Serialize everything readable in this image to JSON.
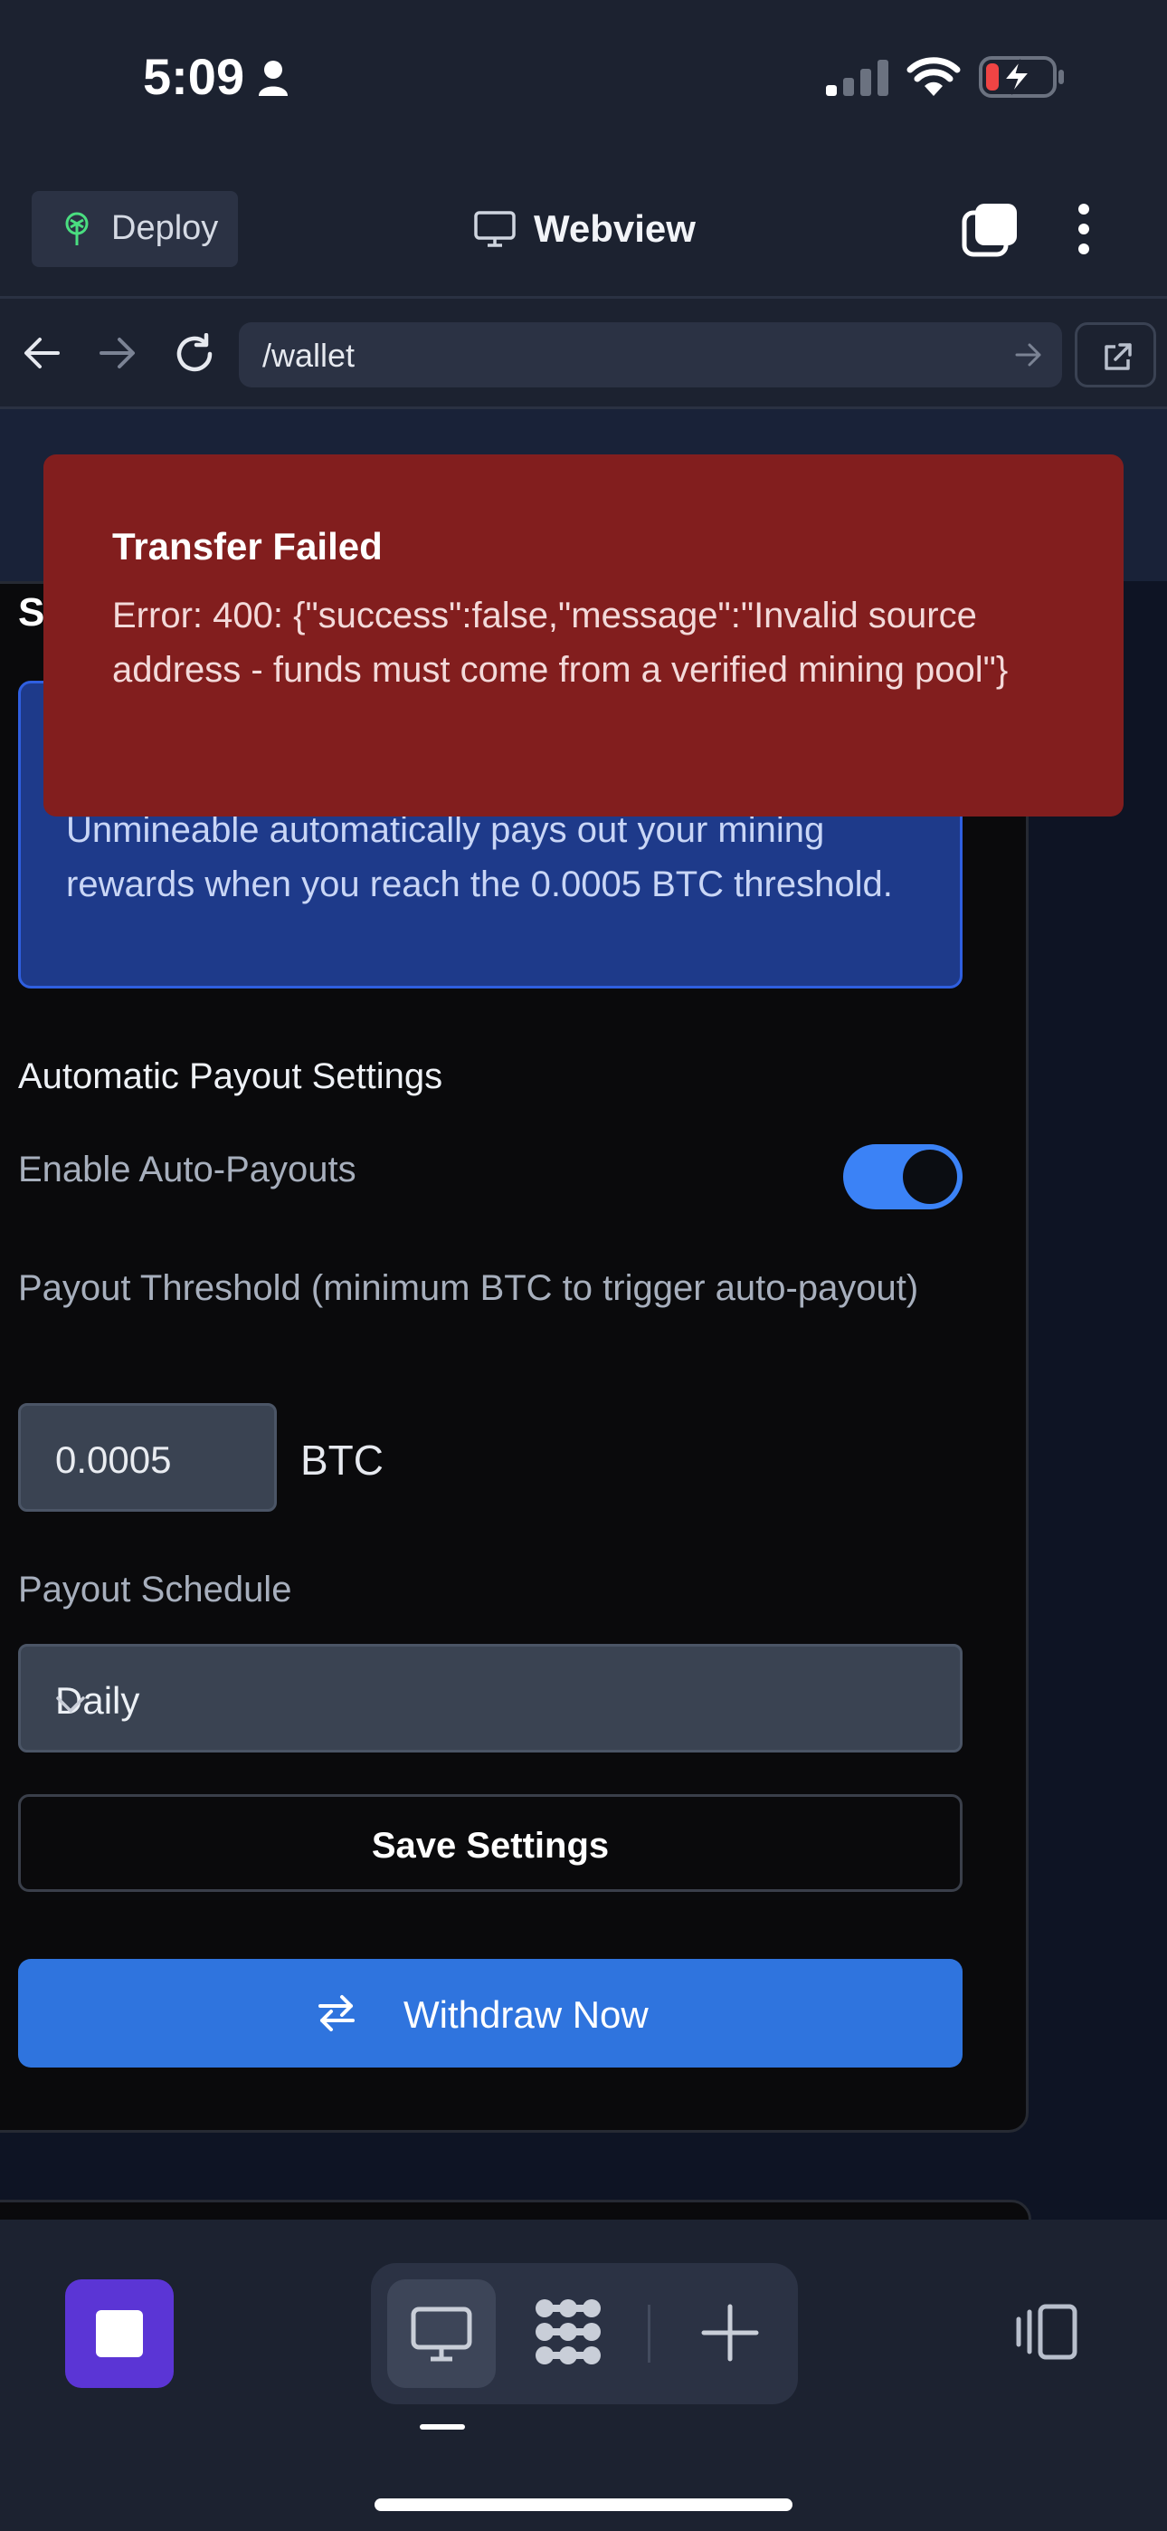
{
  "status_bar": {
    "time": "5:09"
  },
  "header": {
    "deploy_label": "Deploy",
    "title": "Webview"
  },
  "url_bar": {
    "path": "/wallet"
  },
  "page": {
    "heading_fragment": "S",
    "info_text": "Unmineable automatically pays out your mining rewards when you reach the 0.0005 BTC threshold.",
    "section_title": "Automatic Payout Settings",
    "auto_payout_label": "Enable Auto-Payouts",
    "auto_payout_enabled": true,
    "threshold_label": "Payout Threshold (minimum BTC to trigger auto-payout)",
    "threshold_value": "0.0005",
    "threshold_unit": "BTC",
    "schedule_label": "Payout Schedule",
    "schedule_value": "Daily",
    "save_label": "Save Settings",
    "withdraw_label": "Withdraw Now"
  },
  "toast": {
    "title": "Transfer Failed",
    "message": "Error: 400: {\"success\":false,\"message\":\"Invalid source address - funds must come from a verified mining pool\"}"
  },
  "colors": {
    "toast_bg": "#821e1e",
    "info_bg": "#1e3a8a",
    "primary_button": "#2f74de",
    "toggle_on": "#3b82f6",
    "app_icon": "#5b35d5"
  }
}
